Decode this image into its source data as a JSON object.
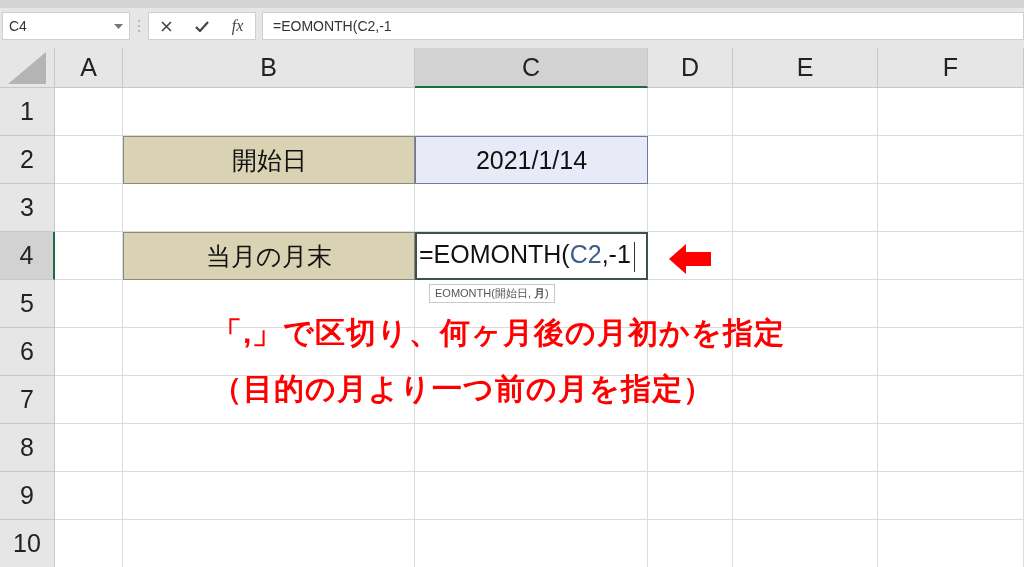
{
  "name_box": {
    "value": "C4"
  },
  "formula_bar": {
    "function_label": "fx",
    "formula": "=EOMONTH(C2,-1"
  },
  "columns": [
    {
      "label": "A",
      "selected": false
    },
    {
      "label": "B",
      "selected": false
    },
    {
      "label": "C",
      "selected": true
    },
    {
      "label": "D",
      "selected": false
    },
    {
      "label": "E",
      "selected": false
    },
    {
      "label": "F",
      "selected": false
    }
  ],
  "rows": [
    {
      "label": "1",
      "selected": false
    },
    {
      "label": "2",
      "selected": false,
      "column_b": {
        "kind": "label",
        "text": "開始日"
      },
      "column_c": {
        "kind": "value",
        "text": "2021/1/14"
      }
    },
    {
      "label": "3",
      "selected": false
    },
    {
      "label": "4",
      "selected": true,
      "column_b": {
        "kind": "label",
        "text": "当月の月末"
      },
      "column_c": {
        "kind": "editing",
        "parts": [
          {
            "text": "=EOMONTH(",
            "ref": false
          },
          {
            "text": "C2",
            "ref": true
          },
          {
            "text": ",-1",
            "ref": false
          }
        ],
        "tooltip": "EOMONTH(開始日, **月**)"
      }
    },
    {
      "label": "5",
      "selected": false
    },
    {
      "label": "6",
      "selected": false
    },
    {
      "label": "7",
      "selected": false
    },
    {
      "label": "8",
      "selected": false
    },
    {
      "label": "9",
      "selected": false
    },
    {
      "label": "10",
      "selected": false
    }
  ],
  "annotation": {
    "lines": [
      "「,」で区切り、何ヶ月後の月初かを指定",
      "（目的の月より一つ前の月を指定）"
    ]
  }
}
